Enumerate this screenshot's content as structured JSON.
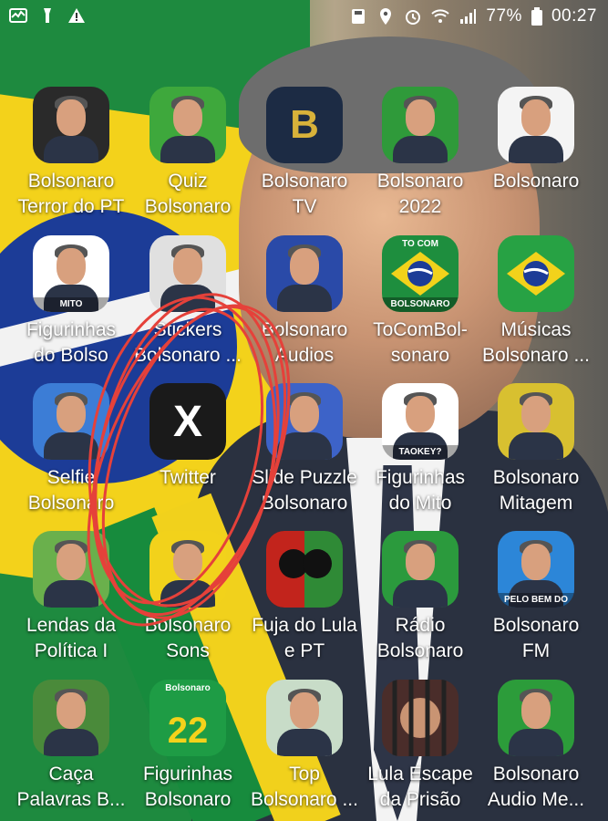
{
  "status_bar": {
    "battery_percent": "77%",
    "time": "00:27",
    "left_icons": [
      "activity-icon",
      "torch-icon",
      "warning-icon"
    ],
    "right_icons": [
      "save-icon",
      "location-icon",
      "alarm-icon",
      "wifi-icon",
      "signal-icon",
      "battery-icon"
    ]
  },
  "apps": [
    {
      "line1": "Bolsonaro",
      "line2": "Terror do PT",
      "icon": "portrait-icon",
      "color": "#2a2a2a"
    },
    {
      "line1": "Quiz",
      "line2": "Bolsonaro",
      "icon": "portrait-icon",
      "color": "#3ea83c"
    },
    {
      "line1": "Bolsonaro",
      "line2": "TV",
      "icon": "b-logo-icon",
      "color": "#1c2b44",
      "glyph": "B"
    },
    {
      "line1": "Bolsonaro",
      "line2": "2022",
      "icon": "running-man-icon",
      "color": "#2f9a3a"
    },
    {
      "line1": "Bolsonaro",
      "line2": "",
      "icon": "portrait-icon",
      "color": "#f4f4f4"
    },
    {
      "line1": "Figurinhas",
      "line2": "do Bolso",
      "icon": "portrait-icon",
      "color": "#ffffff",
      "tag": "MITO"
    },
    {
      "line1": "Stickers",
      "line2": "Bolsonaro ...",
      "icon": "sketch-icon",
      "color": "#e0e0e0"
    },
    {
      "line1": "Bolsonaro",
      "line2": "Audios",
      "icon": "portrait-icon",
      "color": "#2a4aa8"
    },
    {
      "line1": "ToComBol-",
      "line2": "sonaro",
      "icon": "flag-icon",
      "color": "#1e8e3e",
      "tag_top": "TO COM",
      "tag": "BOLSONARO"
    },
    {
      "line1": "Músicas",
      "line2": "Bolsonaro ...",
      "icon": "music-flag-icon",
      "color": "#27a244"
    },
    {
      "line1": "Selfie",
      "line2": "Bolsonaro",
      "icon": "portrait-icon",
      "color": "#3c7dd6"
    },
    {
      "line1": "Twitter",
      "line2": "",
      "icon": "x-logo-icon",
      "color": "#1a1a1a",
      "glyph": "X"
    },
    {
      "line1": "Slide Puzzle",
      "line2": "Bolsonaro",
      "icon": "portrait-icon",
      "color": "#3d63c8"
    },
    {
      "line1": "Figurinhas",
      "line2": "do Mito",
      "icon": "portrait-icon",
      "color": "#ffffff",
      "tag": "TAOKEY?"
    },
    {
      "line1": "Bolsonaro",
      "line2": "Mitagem",
      "icon": "portrait-icon",
      "color": "#d8c030"
    },
    {
      "line1": "Lendas da",
      "line2": "Política I",
      "icon": "portrait-icon",
      "color": "#6ab04c"
    },
    {
      "line1": "Bolsonaro",
      "line2": "Sons",
      "icon": "portrait-icon",
      "color": "#f2d21b"
    },
    {
      "line1": "Fuja do Lula",
      "line2": "e PT",
      "icon": "silhouette-icon",
      "color": "#1d1d1d"
    },
    {
      "line1": "Rádio",
      "line2": "Bolsonaro",
      "icon": "portrait-icon",
      "color": "#2b9a3d"
    },
    {
      "line1": "Bolsonaro",
      "line2": "FM",
      "icon": "portrait-icon",
      "color": "#2c86d8",
      "tag": "PELO BEM DO BRASIL"
    },
    {
      "line1": "Caça",
      "line2": "Palavras B...",
      "icon": "portrait-icon",
      "color": "#4a8a3a"
    },
    {
      "line1": "Figurinhas",
      "line2": "Bolsonaro",
      "icon": "number-22-icon",
      "color": "#1e9c45",
      "glyph": "22",
      "tag_top": "Bolsonaro"
    },
    {
      "line1": "Top",
      "line2": "Bolsonaro ...",
      "icon": "portrait-icon",
      "color": "#c8dcc8"
    },
    {
      "line1": "Lula Escape",
      "line2": "da Prisão",
      "icon": "prison-icon",
      "color": "#4a2d2a"
    },
    {
      "line1": "Bolsonaro",
      "line2": "Audio Me...",
      "icon": "portrait-icon",
      "color": "#2c9c3a"
    }
  ]
}
